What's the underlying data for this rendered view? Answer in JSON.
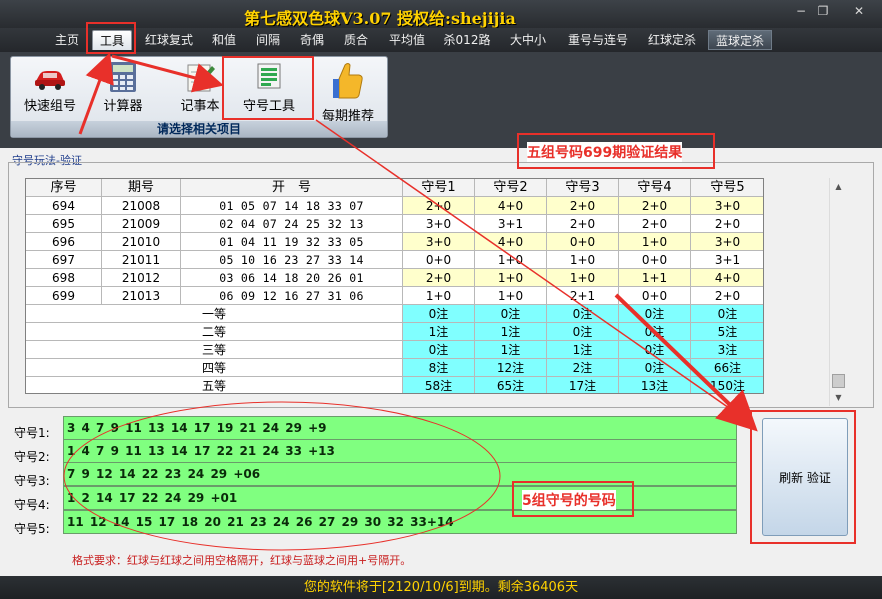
{
  "window": {
    "title": "第七感双色球V3.07  授权给:shejijia",
    "minimize_label": "−",
    "restore_label": "❐",
    "close_label": "✕"
  },
  "menu_tabs": [
    {
      "label": "主页",
      "state": "normal"
    },
    {
      "label": "工具",
      "state": "active"
    },
    {
      "label": "红球复式",
      "state": "normal"
    },
    {
      "label": "和值",
      "state": "normal"
    },
    {
      "label": "间隔",
      "state": "normal"
    },
    {
      "label": "奇偶",
      "state": "normal"
    },
    {
      "label": "质合",
      "state": "normal"
    },
    {
      "label": "平均值",
      "state": "normal"
    },
    {
      "label": "杀012路",
      "state": "normal"
    },
    {
      "label": "大中小",
      "state": "normal"
    },
    {
      "label": "重号与连号",
      "state": "normal"
    },
    {
      "label": "红球定杀",
      "state": "normal"
    },
    {
      "label": "蓝球定杀",
      "state": "highlighted"
    }
  ],
  "ribbon": {
    "caption": "请选择相关项目",
    "items": [
      {
        "label": "快速组号",
        "icon": "car-icon"
      },
      {
        "label": "计算器",
        "icon": "calculator-icon"
      },
      {
        "label": "记事本",
        "icon": "notepad-icon"
      },
      {
        "label": "守号工具",
        "icon": "list-icon"
      },
      {
        "label": "每期推荐",
        "icon": "thumbs-up-icon"
      }
    ]
  },
  "section_title": "守号玩法-验证",
  "table": {
    "headers": [
      "序号",
      "期号",
      "开　号",
      "守号1",
      "守号2",
      "守号3",
      "守号4",
      "守号5"
    ],
    "draws": [
      {
        "seq": "694",
        "issue": "21008",
        "numbers": "01 05 07 14 18 33 07",
        "results": [
          "2+0",
          "4+0",
          "2+0",
          "2+0",
          "3+0"
        ]
      },
      {
        "seq": "695",
        "issue": "21009",
        "numbers": "02 04 07 24 25 32 13",
        "results": [
          "3+0",
          "3+1",
          "2+0",
          "2+0",
          "2+0"
        ]
      },
      {
        "seq": "696",
        "issue": "21010",
        "numbers": "01 04 11 19 32 33 05",
        "results": [
          "3+0",
          "4+0",
          "0+0",
          "1+0",
          "3+0"
        ]
      },
      {
        "seq": "697",
        "issue": "21011",
        "numbers": "05 10 16 23 27 33 14",
        "results": [
          "0+0",
          "1+0",
          "1+0",
          "0+0",
          "3+1"
        ]
      },
      {
        "seq": "698",
        "issue": "21012",
        "numbers": "03 06 14 18 20 26 01",
        "results": [
          "2+0",
          "1+0",
          "1+0",
          "1+1",
          "4+0"
        ]
      },
      {
        "seq": "699",
        "issue": "21013",
        "numbers": "06 09 12 16 27 31 06",
        "results": [
          "1+0",
          "1+0",
          "2+1",
          "0+0",
          "2+0"
        ]
      }
    ],
    "prizes": [
      {
        "label": "一等",
        "values": [
          "0注",
          "0注",
          "0注",
          "0注",
          "0注"
        ]
      },
      {
        "label": "二等",
        "values": [
          "1注",
          "1注",
          "0注",
          "0注",
          "5注"
        ]
      },
      {
        "label": "三等",
        "values": [
          "0注",
          "1注",
          "1注",
          "0注",
          "3注"
        ]
      },
      {
        "label": "四等",
        "values": [
          "8注",
          "12注",
          "2注",
          "0注",
          "66注"
        ]
      },
      {
        "label": "五等",
        "values": [
          "58注",
          "65注",
          "17注",
          "13注",
          "150注"
        ]
      }
    ]
  },
  "groups": [
    {
      "label": "守号1:",
      "value": "3 4 7 9 11 13 14 17 19 21 24 29 +9"
    },
    {
      "label": "守号2:",
      "value": "1 4 7 9 11 13 14 17 22 21 24 33 +13"
    },
    {
      "label": "守号3:",
      "value": "7 9 12 14 22 23 24 29 +06"
    },
    {
      "label": "守号4:",
      "value": "1 2 14 17 22 24 29 +01"
    },
    {
      "label": "守号5:",
      "value": "11 12 14 15 17 18 20 21 23 24 26 27 29 30 32 33+14"
    }
  ],
  "format_note": "格式要求：红球与红球之间用空格隔开，红球与蓝球之间用+号隔开。",
  "refresh_button": "刷新 验证",
  "status": "您的软件将于[2120/10/6]到期。剩余36406天",
  "annotations": {
    "verify_result": "五组号码699期验证结果",
    "group_numbers": "5组守号的号码"
  },
  "colors": {
    "title_yellow": "#ffd200",
    "row_yellow": "#ffffcc",
    "prize_cyan": "#80ffff",
    "group_green": "#80ff80",
    "annotation_red": "#e8302a"
  }
}
